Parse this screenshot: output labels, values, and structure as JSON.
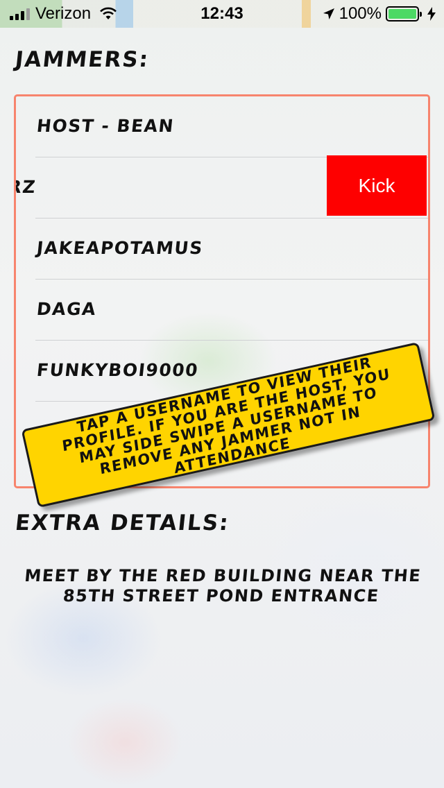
{
  "status_bar": {
    "carrier": "Verizon",
    "time": "12:43",
    "battery_percent": "100%",
    "battery_level": 1.0,
    "icons": [
      "signal-icon",
      "wifi-icon",
      "location-arrow-icon",
      "battery-icon",
      "charging-bolt-icon"
    ]
  },
  "jammers": {
    "heading": "Jammers:",
    "items": [
      {
        "label": "Host - Bean"
      },
      {
        "label": "erz"
      },
      {
        "label": "Jakeapotamus"
      },
      {
        "label": "Daga"
      },
      {
        "label": "FunkyBoi9000"
      }
    ],
    "kick_label": "Kick"
  },
  "tooltip": {
    "text": "Tap a username to view their profile. If you are the host, you may side swipe a username to remove any jammer not in attendance"
  },
  "extra_details": {
    "heading": "Extra Details:",
    "text": "Meet by the red building near the 85th street pond entrance"
  },
  "colors": {
    "list_border": "#f7846d",
    "kick_red": "#fe0000",
    "tooltip_yellow": "#ffd400",
    "battery_green": "#4cd964"
  }
}
